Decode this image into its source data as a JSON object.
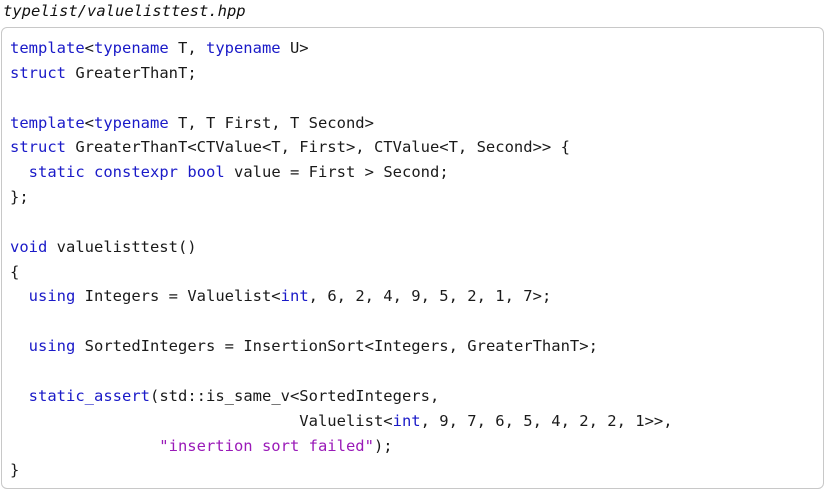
{
  "caption": "typelist/valuelisttest.hpp",
  "colors": {
    "keyword": "#1a1ac8",
    "string": "#9a1ab8",
    "text": "#1a1a1a",
    "frame_border": "#c8c8c8"
  },
  "lines": [
    [
      {
        "t": "template",
        "k": "kw"
      },
      {
        "t": "<",
        "k": "plain"
      },
      {
        "t": "typename",
        "k": "kw"
      },
      {
        "t": " T, ",
        "k": "plain"
      },
      {
        "t": "typename",
        "k": "kw"
      },
      {
        "t": " U>",
        "k": "plain"
      }
    ],
    [
      {
        "t": "struct",
        "k": "kw"
      },
      {
        "t": " GreaterThanT;",
        "k": "plain"
      }
    ],
    [],
    [
      {
        "t": "template",
        "k": "kw"
      },
      {
        "t": "<",
        "k": "plain"
      },
      {
        "t": "typename",
        "k": "kw"
      },
      {
        "t": " T, T First, T Second>",
        "k": "plain"
      }
    ],
    [
      {
        "t": "struct",
        "k": "kw"
      },
      {
        "t": " GreaterThanT<CTValue<T, First>, CTValue<T, Second>> {",
        "k": "plain"
      }
    ],
    [
      {
        "t": "  ",
        "k": "plain"
      },
      {
        "t": "static",
        "k": "kw"
      },
      {
        "t": " ",
        "k": "plain"
      },
      {
        "t": "constexpr",
        "k": "kw"
      },
      {
        "t": " ",
        "k": "plain"
      },
      {
        "t": "bool",
        "k": "kw"
      },
      {
        "t": " value = First > Second;",
        "k": "plain"
      }
    ],
    [
      {
        "t": "};",
        "k": "plain"
      }
    ],
    [],
    [
      {
        "t": "void",
        "k": "kw"
      },
      {
        "t": " valuelisttest()",
        "k": "plain"
      }
    ],
    [
      {
        "t": "{",
        "k": "plain"
      }
    ],
    [
      {
        "t": "  ",
        "k": "plain"
      },
      {
        "t": "using",
        "k": "kw"
      },
      {
        "t": " Integers = Valuelist<",
        "k": "plain"
      },
      {
        "t": "int",
        "k": "kw"
      },
      {
        "t": ", 6, 2, 4, 9, 5, 2, 1, 7>;",
        "k": "plain"
      }
    ],
    [],
    [
      {
        "t": "  ",
        "k": "plain"
      },
      {
        "t": "using",
        "k": "kw"
      },
      {
        "t": " SortedIntegers = InsertionSort<Integers, GreaterThanT>;",
        "k": "plain"
      }
    ],
    [],
    [
      {
        "t": "  ",
        "k": "plain"
      },
      {
        "t": "static_assert",
        "k": "kw"
      },
      {
        "t": "(std::is_same_v<SortedIntegers,",
        "k": "plain"
      }
    ],
    [
      {
        "t": "                               Valuelist<",
        "k": "plain"
      },
      {
        "t": "int",
        "k": "kw"
      },
      {
        "t": ", 9, 7, 6, 5, 4, 2, 2, 1>>,",
        "k": "plain"
      }
    ],
    [
      {
        "t": "                \"insertion sort failed\"",
        "k": "str"
      },
      {
        "t": ");",
        "k": "plain"
      }
    ],
    [
      {
        "t": "}",
        "k": "plain"
      }
    ]
  ]
}
